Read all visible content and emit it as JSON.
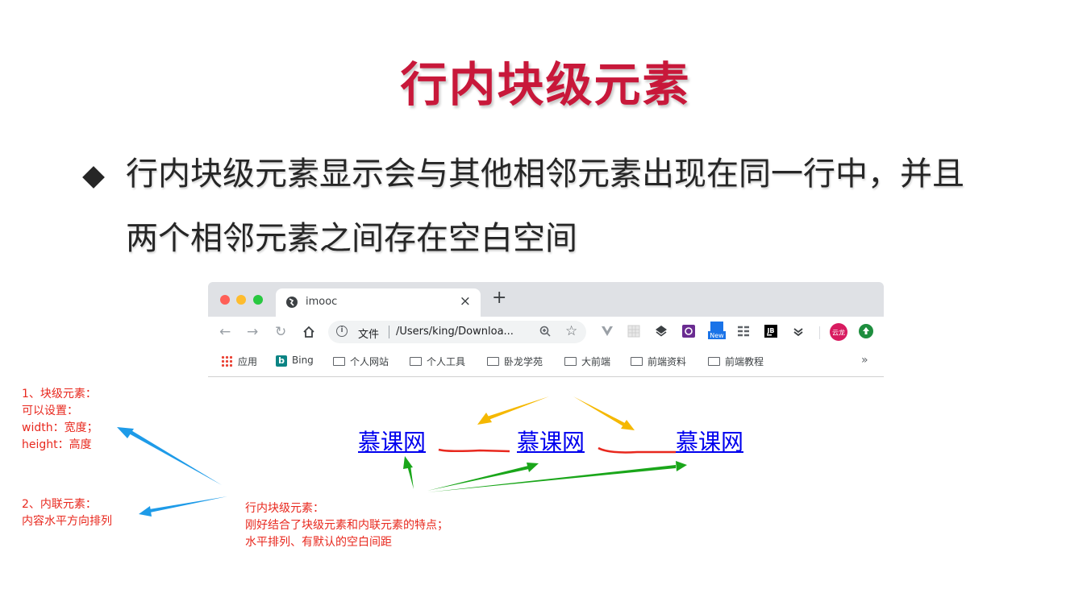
{
  "slide": {
    "title": "行内块级元素",
    "bullet_line1": "行内块级元素显示会与其他相邻元素出现在同一行中，并且",
    "bullet_line2": "两个相邻元素之间存在空白空间"
  },
  "browser": {
    "tab_title": "imooc",
    "tab_close": "×",
    "new_tab": "+",
    "omnibox_label": "文件",
    "url": "/Users/king/Downloa...",
    "extension_new_badge": "New",
    "extension_jb": "JB",
    "profile_badge": "云龙",
    "bookmarks": [
      "应用",
      "Bing",
      "个人网站",
      "个人工具",
      "卧龙学苑",
      "大前端",
      "前端资料",
      "前端教程"
    ],
    "bookmarks_more": "»"
  },
  "page": {
    "links": [
      "慕课网",
      "慕课网",
      "慕课网"
    ]
  },
  "annotations": {
    "block": [
      "1、块级元素：",
      "可以设置：",
      "width：宽度；",
      "height：高度"
    ],
    "inline": [
      "2、内联元素：",
      "内容水平方向排列"
    ],
    "inline_block": [
      "行内块级元素：",
      "刚好结合了块级元素和内联元素的特点；",
      "水平排列、有默认的空白间距"
    ]
  },
  "colors": {
    "title": "#c8183a",
    "annotation_text": "#e8281e",
    "arrow_blue": "#1e9be8",
    "arrow_yellow": "#f5b800",
    "arrow_green": "#1aa61a",
    "underline_red": "#e8281e",
    "link": "#0000ee"
  }
}
